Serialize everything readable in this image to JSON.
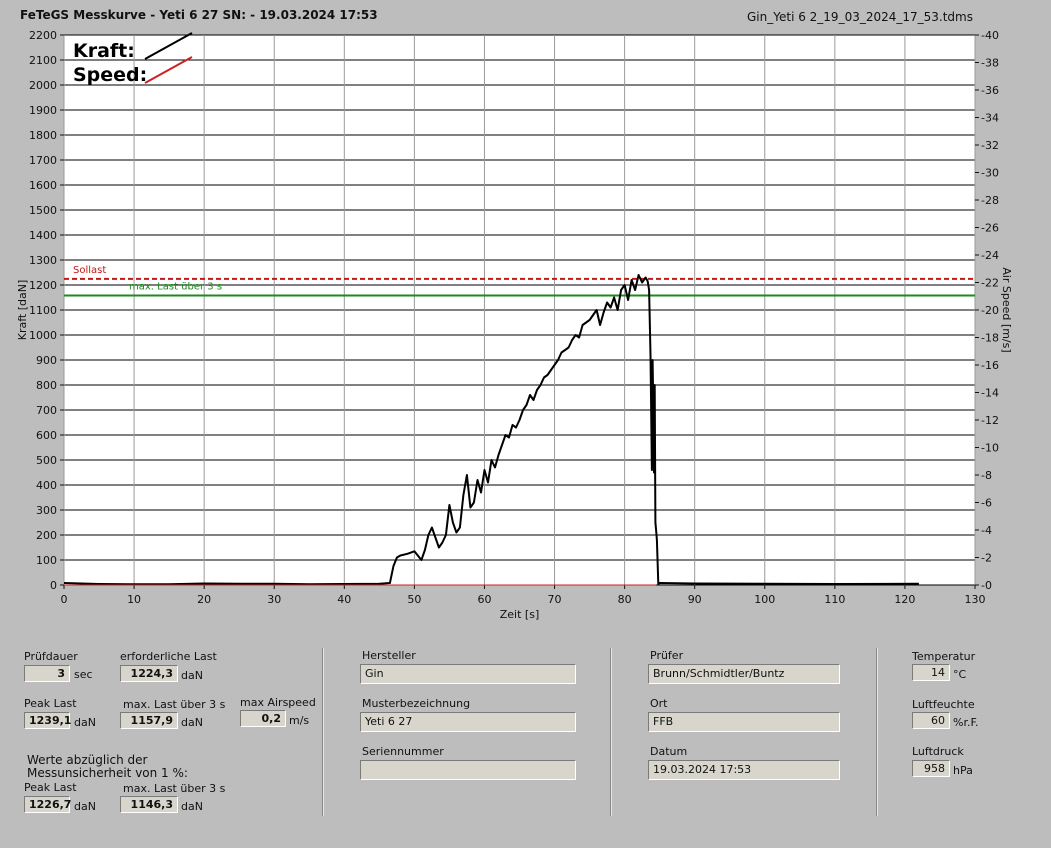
{
  "window": {
    "title": "FeTeGS Messkurve - Yeti 6 27  SN:  - 19.03.2024 17:53",
    "filename": "Gin_Yeti 6 2_19_03_2024_17_53.tdms"
  },
  "chart_data": {
    "type": "line",
    "xlabel": "Zeit [s]",
    "ylabel": "Kraft [daN]",
    "y2label": "Air Speed [m/s]",
    "xlim": [
      0,
      130
    ],
    "ylim": [
      0,
      2200
    ],
    "y2lim": [
      0,
      40
    ],
    "xticks": [
      0,
      10,
      20,
      30,
      40,
      50,
      60,
      70,
      80,
      90,
      100,
      110,
      120,
      130
    ],
    "yticks": [
      0,
      100,
      200,
      300,
      400,
      500,
      600,
      700,
      800,
      900,
      1000,
      1100,
      1200,
      1300,
      1400,
      1500,
      1600,
      1700,
      1800,
      1900,
      2000,
      2100,
      2200
    ],
    "y2ticks": [
      0,
      2,
      4,
      6,
      8,
      10,
      12,
      14,
      16,
      18,
      20,
      22,
      24,
      26,
      28,
      30,
      32,
      34,
      36,
      38,
      40
    ],
    "grid": true,
    "legend": {
      "placement": "top-left",
      "entries": [
        {
          "name": "Kraft:",
          "color": "#000000"
        },
        {
          "name": "Speed:",
          "color": "#cc2222"
        }
      ]
    },
    "reference_lines": [
      {
        "label": "Sollast",
        "y": 1224.3,
        "color": "#c01818",
        "style": "dashed"
      },
      {
        "label": "max. Last über  3 s",
        "y": 1157.9,
        "color": "#1e8a1e",
        "style": "solid"
      }
    ],
    "series": [
      {
        "name": "Kraft:",
        "color": "#000000",
        "x": [
          0,
          5,
          10,
          15,
          20,
          25,
          30,
          35,
          40,
          45,
          46.5,
          47,
          47.5,
          48,
          49,
          50,
          51,
          51.5,
          52,
          52.5,
          53,
          53.5,
          54,
          54.5,
          55,
          55.5,
          56,
          56.5,
          57,
          57.5,
          58,
          58.5,
          59,
          59.5,
          60,
          60.5,
          61,
          61.5,
          62,
          62.5,
          63,
          63.5,
          64,
          64.5,
          65,
          65.5,
          66,
          66.5,
          67,
          67.5,
          68,
          68.5,
          69,
          69.5,
          70,
          70.5,
          71,
          71.5,
          72,
          72.5,
          73,
          73.5,
          74,
          74.5,
          75,
          75.5,
          76,
          76.5,
          77,
          77.5,
          78,
          78.5,
          79,
          79.5,
          80,
          80.5,
          81,
          81.5,
          82,
          82.5,
          83,
          83.3,
          83.5,
          83.7,
          83.9,
          84.0,
          84.1,
          84.2,
          84.3,
          84.4,
          84.5,
          84.6,
          84.8,
          85,
          90,
          100,
          110,
          122
        ],
        "values": [
          8,
          4,
          3,
          3,
          6,
          5,
          5,
          3,
          4,
          5,
          8,
          75,
          110,
          118,
          125,
          135,
          100,
          140,
          200,
          230,
          190,
          150,
          170,
          200,
          320,
          250,
          210,
          230,
          360,
          440,
          310,
          330,
          420,
          370,
          460,
          410,
          500,
          470,
          520,
          560,
          600,
          590,
          640,
          630,
          660,
          700,
          720,
          760,
          740,
          780,
          800,
          830,
          840,
          860,
          880,
          900,
          930,
          940,
          950,
          980,
          1000,
          990,
          1040,
          1050,
          1060,
          1080,
          1100,
          1040,
          1090,
          1130,
          1110,
          1150,
          1100,
          1180,
          1200,
          1140,
          1220,
          1180,
          1240,
          1210,
          1230,
          1215,
          1180,
          920,
          460,
          900,
          700,
          450,
          800,
          250,
          220,
          180,
          5,
          8,
          6,
          5,
          4,
          5
        ]
      },
      {
        "name": "Speed:",
        "color": "#cc2222",
        "x": [
          0,
          84.5
        ],
        "values": [
          0,
          0
        ]
      }
    ]
  },
  "panel": {
    "pruefdauer": {
      "label": "Prüfdauer",
      "value": "3",
      "unit": "sec"
    },
    "erforderliche_last": {
      "label": "erforderliche Last",
      "value": "1224,3",
      "unit": "daN"
    },
    "peak_last": {
      "label": "Peak Last",
      "value": "1239,1",
      "unit": "daN"
    },
    "max_last": {
      "label": "max. Last über  3 s",
      "value": "1157,9",
      "unit": "daN"
    },
    "max_airspeed": {
      "label": "max Airspeed",
      "value": "0,2",
      "unit": "m/s"
    },
    "werte_note": "Werte abzüglich der Messunsicherheit von 1  %:",
    "peak_last_corr": {
      "label": "Peak Last",
      "value": "1226,7",
      "unit": "daN"
    },
    "max_last_corr": {
      "label": "max. Last über  3 s",
      "value": "1146,3",
      "unit": "daN"
    },
    "hersteller": {
      "label": "Hersteller",
      "value": "Gin"
    },
    "musterbezeichnung": {
      "label": "Musterbezeichnung",
      "value": "Yeti 6 27"
    },
    "seriennummer": {
      "label": "Seriennummer",
      "value": ""
    },
    "pruefer": {
      "label": "Prüfer",
      "value": "Brunn/Schmidtler/Buntz"
    },
    "ort": {
      "label": "Ort",
      "value": "FFB"
    },
    "datum": {
      "label": "Datum",
      "value": "19.03.2024 17:53"
    },
    "temperatur": {
      "label": "Temperatur",
      "value": "14",
      "unit": "°C"
    },
    "luftfeuchte": {
      "label": "Luftfeuchte",
      "value": "60",
      "unit": "%r.F."
    },
    "luftdruck": {
      "label": "Luftdruck",
      "value": "958",
      "unit": "hPa"
    }
  },
  "colors": {
    "background": "#bdbdbd",
    "plot_bg": "#ffffff",
    "grid": "#000000"
  }
}
